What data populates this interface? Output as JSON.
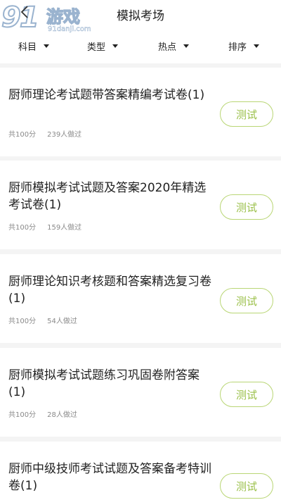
{
  "header": {
    "title": "模拟考场",
    "watermark": {
      "number": "91",
      "name": "游戏",
      "site": "91danji.com"
    }
  },
  "filters": [
    {
      "label": "科目"
    },
    {
      "label": "类型"
    },
    {
      "label": "热点"
    },
    {
      "label": "排序"
    }
  ],
  "exams": [
    {
      "title": "厨师理论考试题带答案精编考试卷(1)",
      "total": "共100分",
      "takers": "239人做过",
      "action": "测试"
    },
    {
      "title": "厨师模拟考试试题及答案2020年精选考试卷(1)",
      "total": "共100分",
      "takers": "159人做过",
      "action": "测试"
    },
    {
      "title": "厨师理论知识考核题和答案精选复习卷(1)",
      "total": "共100分",
      "takers": "54人做过",
      "action": "测试"
    },
    {
      "title": "厨师模拟考试试题练习巩固卷附答案(1)",
      "total": "共100分",
      "takers": "28人做过",
      "action": "测试"
    },
    {
      "title": "厨师中级技师考试试题及答案备考特训卷(1)",
      "total": "",
      "takers": "",
      "action": "测试"
    }
  ],
  "colors": {
    "accent": "#9bc04a",
    "accent_border": "#b9d675",
    "background": "#f4f4f4"
  }
}
